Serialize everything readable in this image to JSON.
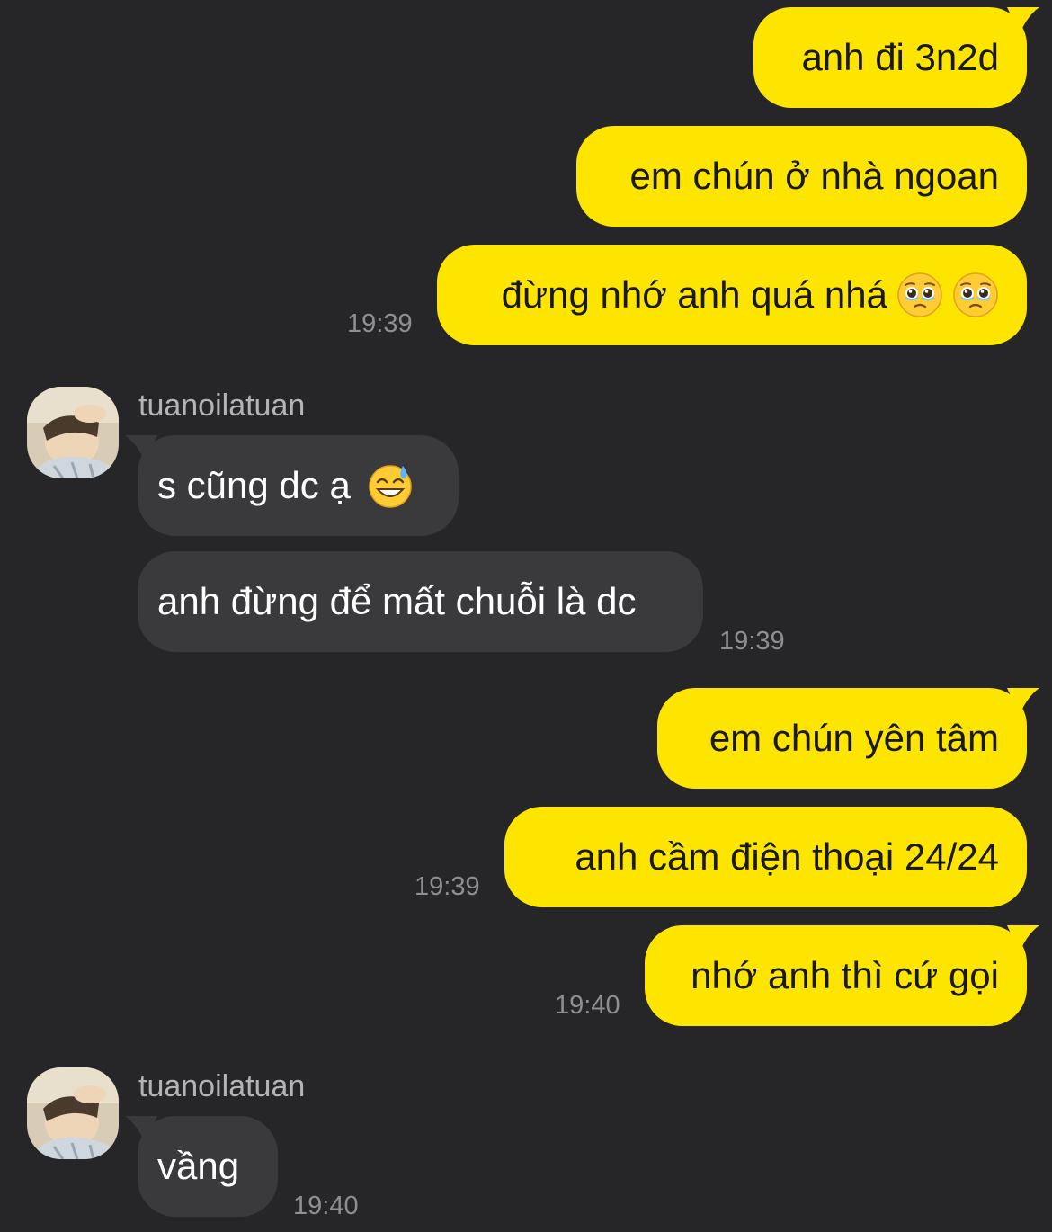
{
  "chat": {
    "group1": {
      "msg1": "anh đi 3n2d",
      "msg2": "em chún ở nhà ngoan",
      "msg3": "đừng nhớ anh quá nhá",
      "msg3_emojis": [
        "pleading-face-emoji",
        "pleading-face-emoji"
      ],
      "time": "19:39"
    },
    "group2": {
      "sender": "tuanoilatuan",
      "msg1": "s cũng dc ạ",
      "msg1_emoji": "grinning-face-with-sweat-emoji",
      "msg2": "anh đừng để mất chuỗi là dc",
      "time": "19:39"
    },
    "group3": {
      "msg1": "em chún yên tâm",
      "msg2": "anh cầm điện thoại 24/24",
      "time": "19:39"
    },
    "group4": {
      "msg1": "nhớ anh thì cứ gọi",
      "time": "19:40"
    },
    "group5": {
      "sender": "tuanoilatuan",
      "msg1": "vầng",
      "time": "19:40"
    }
  },
  "colors": {
    "background": "#262628",
    "outgoing_bubble": "#fee500",
    "incoming_bubble": "#3a3a3c",
    "timestamp": "#8e8e93"
  }
}
